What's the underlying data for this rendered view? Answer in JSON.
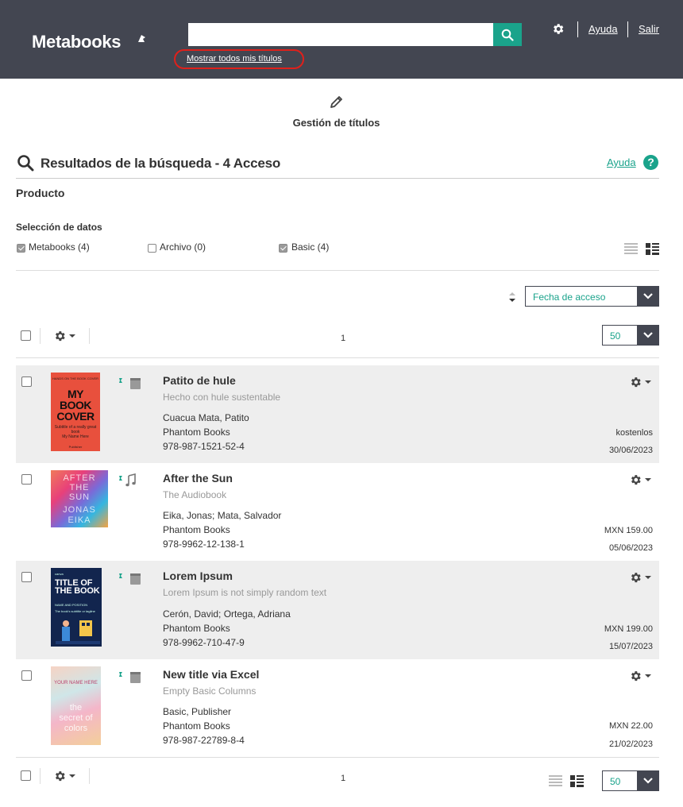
{
  "header": {
    "logo": "Metabooks",
    "search": {
      "value": "",
      "placeholder": ""
    },
    "show_all_link": "Mostrar todos mis títulos",
    "help_link": "Ayuda",
    "logout_link": "Salir",
    "brand_color": "#434651",
    "accent_color": "#1aa38b"
  },
  "management": {
    "title": "Gestión de títulos"
  },
  "results": {
    "title": "Resultados de la búsqueda - 4 Acceso",
    "help_link": "Ayuda",
    "help_icon": "?",
    "section_label": "Producto"
  },
  "data_selection": {
    "label": "Selección de datos",
    "options": [
      {
        "label": "Metabooks (4)",
        "checked": true
      },
      {
        "label": "Archivo (0)",
        "checked": false
      },
      {
        "label": "Basic (4)",
        "checked": true
      }
    ]
  },
  "sort": {
    "selected": "Fecha de acceso"
  },
  "pagination": {
    "page": "1",
    "per_page": "50"
  },
  "rows": [
    {
      "title": "Patito de hule",
      "subtitle": "Hecho con hule sustentable",
      "contributors": "Cuacua Mata, Patito",
      "publisher": "Phantom Books",
      "isbn": "978-987-1521-52-4",
      "price": "kostenlos",
      "date": "30/06/2023",
      "format_icon": "book-icon",
      "cover": {
        "top": "HANDS ON THE BOOK COVER",
        "big": "MY BOOK COVER",
        "tag": "Subtitle of a really great book",
        "author": "My Name Here",
        "foot": "Publisher"
      }
    },
    {
      "title": "After the Sun",
      "subtitle": "The Audiobook",
      "contributors": "Eika, Jonas; Mata, Salvador",
      "publisher": "Phantom Books",
      "isbn": "978-9962-12-138-1",
      "price": "MXN 159.00",
      "date": "05/06/2023",
      "format_icon": "music-note-icon",
      "cover": {
        "line1": "AFTER",
        "line2": "THE",
        "line3": "SUN",
        "line4": "JONAS",
        "line5": "EIKA"
      }
    },
    {
      "title": "Lorem Ipsum",
      "subtitle": "Lorem Ipsum is not simply random text",
      "contributors": "Cerón, David; Ortega, Adriana",
      "publisher": "Phantom Books",
      "isbn": "978-9962-710-47-9",
      "price": "MXN 199.00",
      "date": "15/07/2023",
      "format_icon": "book-icon",
      "cover": {
        "top": "canva",
        "big": "TITLE OF THE BOOK",
        "author": "NAME AND POSITION",
        "tag": "The book's subtitle or tagline"
      }
    },
    {
      "title": "New title via Excel",
      "subtitle": "Empty Basic Columns",
      "contributors": "Basic, Publisher",
      "publisher": "Phantom Books",
      "isbn": "978-987-22789-8-4",
      "price": "MXN 22.00",
      "date": "21/02/2023",
      "format_icon": "book-icon",
      "cover": {
        "name": "YOUR NAME HERE",
        "line1": "the",
        "line2": "secret of",
        "line3": "colors"
      }
    }
  ]
}
